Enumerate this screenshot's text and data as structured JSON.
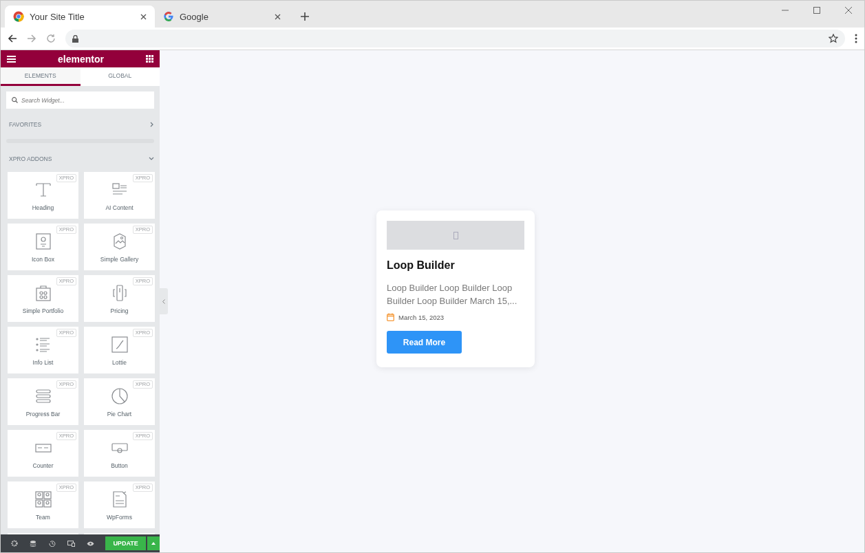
{
  "browser": {
    "tabs": [
      {
        "title": "Your Site Title",
        "selected": true
      },
      {
        "title": "Google",
        "selected": false
      }
    ]
  },
  "editor": {
    "logo": "elementor",
    "tabs": [
      {
        "label": "ELEMENTS",
        "selected": true
      },
      {
        "label": "GLOBAL",
        "selected": false
      }
    ],
    "search": {
      "placeholder": "Search Widget..."
    },
    "sections": [
      {
        "label": "FAVORITES",
        "expanded": false
      },
      {
        "label": "XPRO ADDONS",
        "expanded": true
      }
    ],
    "widgets": [
      {
        "label": "Heading",
        "badge": "XPRO"
      },
      {
        "label": "AI Content",
        "badge": "XPRO"
      },
      {
        "label": "Icon Box",
        "badge": "XPRO"
      },
      {
        "label": "Simple Gallery",
        "badge": "XPRO"
      },
      {
        "label": "Simple Portfolio",
        "badge": "XPRO"
      },
      {
        "label": "Pricing",
        "badge": "XPRO"
      },
      {
        "label": "Info List",
        "badge": "XPRO"
      },
      {
        "label": "Lottie",
        "badge": "XPRO"
      },
      {
        "label": "Progress Bar",
        "badge": "XPRO"
      },
      {
        "label": "Pie Chart",
        "badge": "XPRO"
      },
      {
        "label": "Counter",
        "badge": "XPRO"
      },
      {
        "label": "Button",
        "badge": "XPRO"
      },
      {
        "label": "Team",
        "badge": "XPRO"
      },
      {
        "label": "WpForms",
        "badge": "XPRO"
      }
    ],
    "update": "UPDATE"
  },
  "canvas": {
    "card": {
      "title": "Loop Builder",
      "excerpt": "Loop Builder Loop Builder Loop Builder Loop Builder March 15,...",
      "date": "March 15, 2023",
      "button": "Read More"
    }
  }
}
